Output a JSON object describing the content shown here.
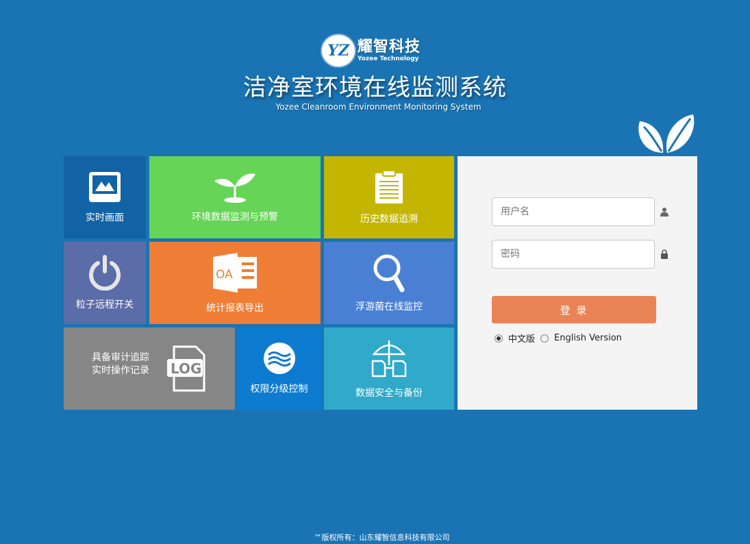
{
  "header": {
    "logo_mark": "YZ",
    "logo_cn": "耀智科技",
    "logo_en": "Yozee Technology",
    "title": "洁净室环境在线监测系统",
    "subtitle": "Yozee Cleanroom Environment Monitoring System"
  },
  "tiles": {
    "realtime": {
      "label": "实时画面",
      "icon": "picture-icon"
    },
    "env": {
      "label": "环境数据监测与预警",
      "icon": "sprout-icon"
    },
    "history": {
      "label": "历史数据追溯",
      "icon": "clipboard-icon"
    },
    "power": {
      "label": "粒子远程开关",
      "icon": "power-icon"
    },
    "report": {
      "label": "统计报表导出",
      "icon": "oa-report-icon",
      "icon_text": "OA"
    },
    "bacteria": {
      "label": "浮游菌在线监控",
      "icon": "magnifier-icon"
    },
    "log": {
      "line1": "具备审计追踪",
      "line2": "实时操作记录",
      "icon": "log-file-icon",
      "icon_text": "LOG"
    },
    "perm": {
      "label": "权限分级控制",
      "icon": "waves-icon"
    },
    "backup": {
      "label": "数据安全与备份",
      "icon": "umbrella-files-icon"
    }
  },
  "login": {
    "username_placeholder": "用户名",
    "password_placeholder": "密码",
    "button_label": "登  录",
    "lang_cn": "中文版",
    "lang_en": "English Version",
    "selected_lang": "中文版"
  },
  "footer": {
    "text": "™版权所有：山东耀智信息科技有限公司"
  },
  "colors": {
    "background": "#1a74b4",
    "realtime": "#1163a6",
    "env": "#66d456",
    "history": "#c4b600",
    "power": "#5b6da8",
    "report": "#f07d35",
    "bacteria": "#4a80d4",
    "log": "#868686",
    "perm": "#0c7bd0",
    "backup": "#30a9ca",
    "login_button": "#ea8456"
  }
}
